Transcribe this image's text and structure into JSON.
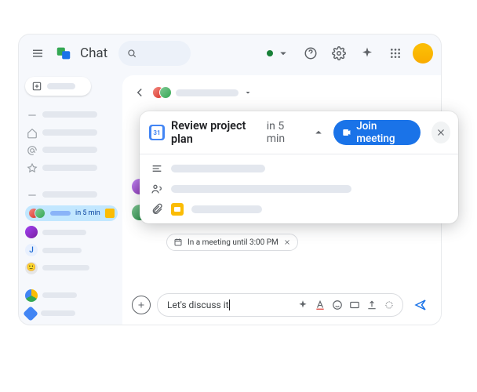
{
  "app_title": "Chat",
  "active_chat_time": "in 5 min",
  "popover": {
    "title": "Review project plan",
    "subtitle": "in 5 min",
    "join_label": "Join meeting"
  },
  "status_chip": "In a meeting until 3:00 PM",
  "composer_text": "Let's discuss it",
  "user_letter": "J",
  "user_emoji": "🙂"
}
